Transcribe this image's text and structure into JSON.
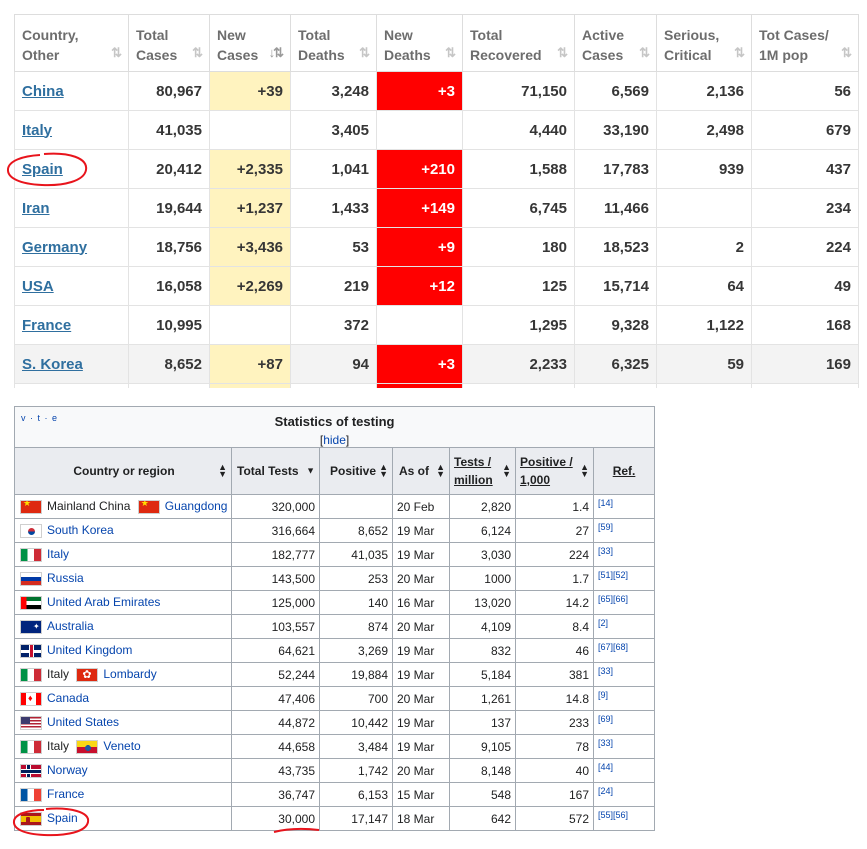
{
  "top_table": {
    "headers": [
      {
        "label": "Country,\nOther",
        "sort": "⇅"
      },
      {
        "label": "Total\nCases",
        "sort": "⇅"
      },
      {
        "label": "New\nCases",
        "sort": "↓⇅"
      },
      {
        "label": "Total\nDeaths",
        "sort": "⇅"
      },
      {
        "label": "New\nDeaths",
        "sort": "⇅"
      },
      {
        "label": "Total\nRecovered",
        "sort": "⇅"
      },
      {
        "label": "Active\nCases",
        "sort": "⇅"
      },
      {
        "label": "Serious,\nCritical",
        "sort": "⇅"
      },
      {
        "label": "Tot Cases/\n1M pop",
        "sort": "⇅"
      }
    ],
    "rows": [
      {
        "country": "China",
        "total_cases": "80,967",
        "new_cases": "+39",
        "total_deaths": "3,248",
        "new_deaths": "+3",
        "recovered": "71,150",
        "active": "6,569",
        "serious": "2,136",
        "per_million": "56"
      },
      {
        "country": "Italy",
        "total_cases": "41,035",
        "new_cases": "",
        "total_deaths": "3,405",
        "new_deaths": "",
        "recovered": "4,440",
        "active": "33,190",
        "serious": "2,498",
        "per_million": "679"
      },
      {
        "country": "Spain",
        "total_cases": "20,412",
        "new_cases": "+2,335",
        "total_deaths": "1,041",
        "new_deaths": "+210",
        "recovered": "1,588",
        "active": "17,783",
        "serious": "939",
        "per_million": "437"
      },
      {
        "country": "Iran",
        "total_cases": "19,644",
        "new_cases": "+1,237",
        "total_deaths": "1,433",
        "new_deaths": "+149",
        "recovered": "6,745",
        "active": "11,466",
        "serious": "",
        "per_million": "234"
      },
      {
        "country": "Germany",
        "total_cases": "18,756",
        "new_cases": "+3,436",
        "total_deaths": "53",
        "new_deaths": "+9",
        "recovered": "180",
        "active": "18,523",
        "serious": "2",
        "per_million": "224"
      },
      {
        "country": "USA",
        "total_cases": "16,058",
        "new_cases": "+2,269",
        "total_deaths": "219",
        "new_deaths": "+12",
        "recovered": "125",
        "active": "15,714",
        "serious": "64",
        "per_million": "49"
      },
      {
        "country": "France",
        "total_cases": "10,995",
        "new_cases": "",
        "total_deaths": "372",
        "new_deaths": "",
        "recovered": "1,295",
        "active": "9,328",
        "serious": "1,122",
        "per_million": "168"
      },
      {
        "country": "S. Korea",
        "total_cases": "8,652",
        "new_cases": "+87",
        "total_deaths": "94",
        "new_deaths": "+3",
        "recovered": "2,233",
        "active": "6,325",
        "serious": "59",
        "per_million": "169"
      }
    ]
  },
  "testing_table": {
    "navbox": "v · t · e",
    "title": "Statistics of testing",
    "hide_open": "[",
    "hide_link": "hide",
    "hide_close": "]",
    "headers": {
      "country": "Country or region",
      "total_tests": "Total Tests",
      "positive": "Positive",
      "as_of": "As of",
      "tests_per_million": "Tests / million",
      "positive_per_1000": "Positive / 1,000",
      "ref": "Ref."
    },
    "rows": [
      {
        "flag": "cn",
        "name": "Mainland China",
        "sub_flag": "cn",
        "sub_name": "Guangdong",
        "name_plain": true,
        "total": "320,000",
        "positive": "",
        "as_of": "20 Feb",
        "tpm": "2,820",
        "ppt": "1.4",
        "ref": "[14]"
      },
      {
        "flag": "kr",
        "name": "South Korea",
        "total": "316,664",
        "positive": "8,652",
        "as_of": "19 Mar",
        "tpm": "6,124",
        "ppt": "27",
        "ref": "[59]"
      },
      {
        "flag": "it",
        "name": "Italy",
        "total": "182,777",
        "positive": "41,035",
        "as_of": "19 Mar",
        "tpm": "3,030",
        "ppt": "224",
        "ref": "[33]"
      },
      {
        "flag": "ru",
        "name": "Russia",
        "total": "143,500",
        "positive": "253",
        "as_of": "20 Mar",
        "tpm": "1000",
        "ppt": "1.7",
        "ref": "[51][52]"
      },
      {
        "flag": "ae",
        "name": "United Arab Emirates",
        "total": "125,000",
        "positive": "140",
        "as_of": "16 Mar",
        "tpm": "13,020",
        "ppt": "14.2",
        "ref": "[65][66]"
      },
      {
        "flag": "au",
        "name": "Australia",
        "total": "103,557",
        "positive": "874",
        "as_of": "20 Mar",
        "tpm": "4,109",
        "ppt": "8.4",
        "ref": "[2]"
      },
      {
        "flag": "gb",
        "name": "United Kingdom",
        "total": "64,621",
        "positive": "3,269",
        "as_of": "19 Mar",
        "tpm": "832",
        "ppt": "46",
        "ref": "[67][68]"
      },
      {
        "flag": "it",
        "name": "Italy",
        "sub_flag": "hk",
        "sub_name": "Lombardy",
        "name_plain": true,
        "total": "52,244",
        "positive": "19,884",
        "as_of": "19 Mar",
        "tpm": "5,184",
        "ppt": "381",
        "ref": "[33]"
      },
      {
        "flag": "ca",
        "name": "Canada",
        "total": "47,406",
        "positive": "700",
        "as_of": "20 Mar",
        "tpm": "1,261",
        "ppt": "14.8",
        "ref": "[9]"
      },
      {
        "flag": "us",
        "name": "United States",
        "total": "44,872",
        "positive": "10,442",
        "as_of": "19 Mar",
        "tpm": "137",
        "ppt": "233",
        "ref": "[69]"
      },
      {
        "flag": "it",
        "name": "Italy",
        "sub_flag": "ve",
        "sub_name": "Veneto",
        "name_plain": true,
        "total": "44,658",
        "positive": "3,484",
        "as_of": "19 Mar",
        "tpm": "9,105",
        "ppt": "78",
        "ref": "[33]"
      },
      {
        "flag": "no",
        "name": "Norway",
        "total": "43,735",
        "positive": "1,742",
        "as_of": "20 Mar",
        "tpm": "8,148",
        "ppt": "40",
        "ref": "[44]"
      },
      {
        "flag": "fr",
        "name": "France",
        "total": "36,747",
        "positive": "6,153",
        "as_of": "15 Mar",
        "tpm": "548",
        "ppt": "167",
        "ref": "[24]"
      },
      {
        "flag": "es",
        "name": "Spain",
        "total": "30,000",
        "positive": "17,147",
        "as_of": "18 Mar",
        "tpm": "642",
        "ppt": "572",
        "ref": "[55][56]"
      }
    ]
  },
  "colors": {
    "link": "#2f6f9f",
    "wiki_link": "#0645ad",
    "new_cases_bg": "#fff3bf",
    "new_deaths_bg": "#ff0000",
    "annotation": "#e8141c"
  }
}
